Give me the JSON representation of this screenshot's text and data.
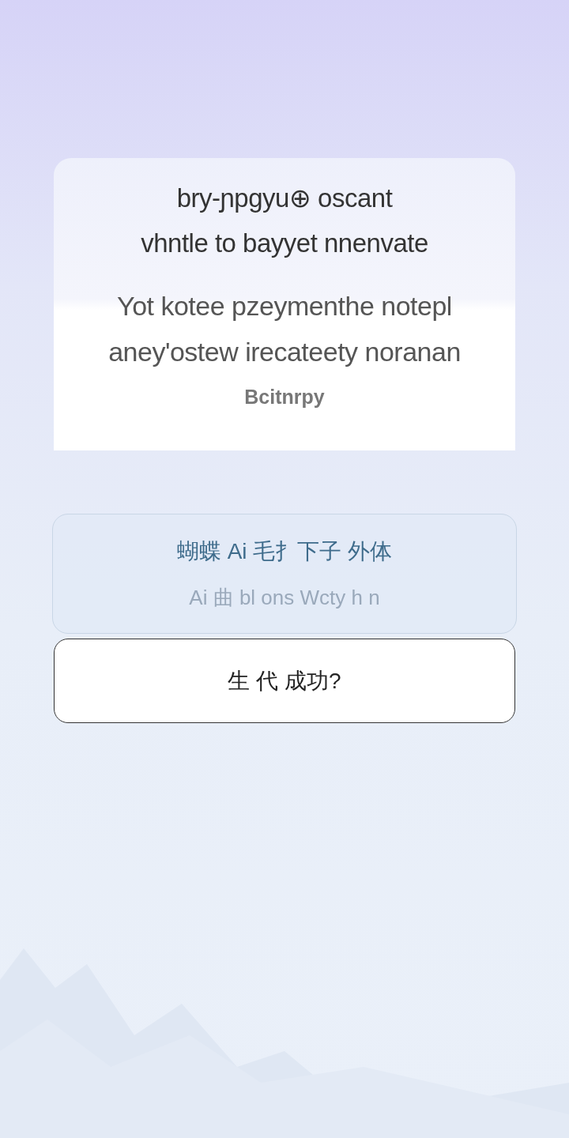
{
  "dialog": {
    "title_lines": [
      "bry-ɲpgyu⊕ oscant",
      "vhntle to bayyet nnenvate"
    ],
    "message_lines": [
      "Yot kotee pzeymenthe notepl",
      "aney'ostew irecateety noranan"
    ],
    "footnote": "Bcitnrpy"
  },
  "notice": {
    "heading": "蝴蝶 Ai 毛扌下子 外体",
    "subtext": "Ai 曲 bl ons Wcty h n"
  },
  "action_button": {
    "label": "生 代 成功?"
  }
}
